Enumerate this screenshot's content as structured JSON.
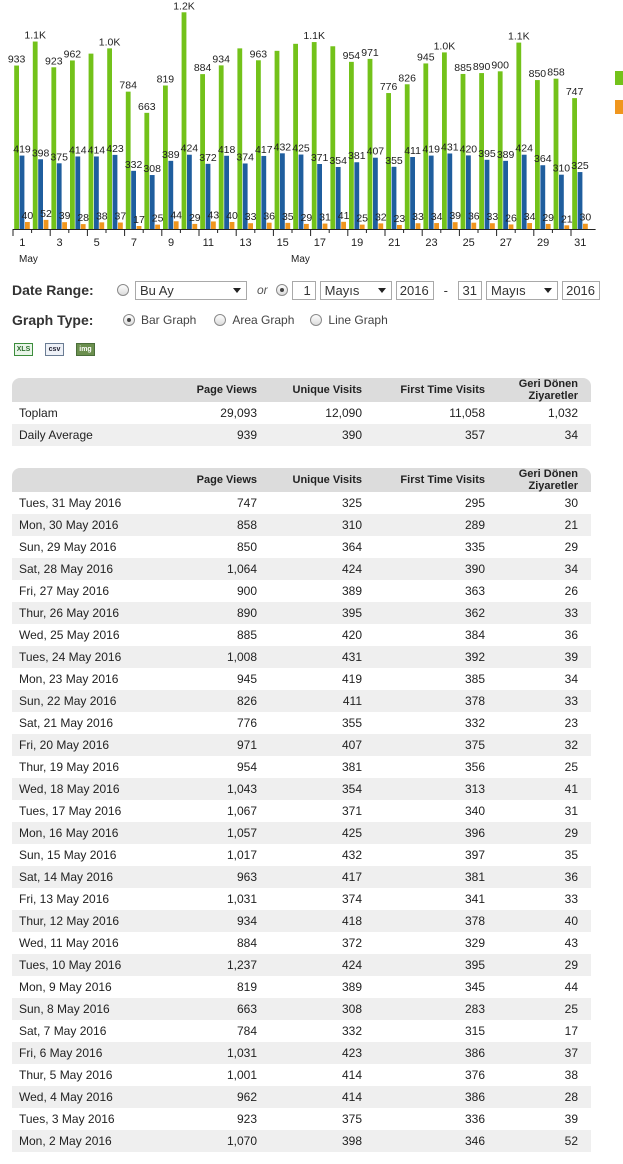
{
  "chart_data": {
    "type": "bar",
    "x": [
      1,
      2,
      3,
      4,
      5,
      6,
      7,
      8,
      9,
      10,
      11,
      12,
      13,
      14,
      15,
      16,
      17,
      18,
      19,
      20,
      21,
      22,
      23,
      24,
      25,
      26,
      27,
      28,
      29,
      30,
      31
    ],
    "x_tick_labels": [
      "1",
      "3",
      "5",
      "7",
      "9",
      "11",
      "13",
      "15",
      "17",
      "19",
      "21",
      "23",
      "25",
      "27",
      "29",
      "31"
    ],
    "month_labels": [
      "May",
      "May"
    ],
    "series": [
      {
        "color": "#73c21a",
        "values": [
          933,
          1070,
          923,
          962,
          1001,
          1031,
          784,
          663,
          819,
          1237,
          884,
          934,
          1031,
          963,
          1017,
          1057,
          1067,
          1043,
          954,
          971,
          776,
          826,
          945,
          1008,
          885,
          890,
          900,
          1064,
          850,
          858,
          747
        ],
        "labels": [
          "933",
          "1.1K",
          "923",
          "962",
          "",
          "1.0K",
          "784",
          "663",
          "819",
          "1.2K",
          "884",
          "934",
          "",
          "963",
          "",
          "",
          "1.1K",
          "",
          "954",
          "971",
          "776",
          "826",
          "945",
          "1.0K",
          "885",
          "890",
          "900",
          "1.1K",
          "850",
          "858",
          "747"
        ]
      },
      {
        "color": "#1f5e9e",
        "values": [
          419,
          398,
          375,
          414,
          414,
          423,
          332,
          308,
          389,
          424,
          372,
          418,
          374,
          417,
          432,
          425,
          371,
          354,
          381,
          407,
          355,
          411,
          419,
          431,
          420,
          395,
          389,
          424,
          364,
          310,
          325
        ],
        "labels": [
          "419",
          "398",
          "375",
          "414",
          "414",
          "423",
          "332",
          "308",
          "389",
          "424",
          "372",
          "418",
          "374",
          "417",
          "432",
          "425",
          "371",
          "354",
          "381",
          "407",
          "355",
          "411",
          "419",
          "431",
          "420",
          "395",
          "389",
          "424",
          "364",
          "310",
          "325"
        ]
      },
      {
        "color": "#f0961e",
        "values": [
          40,
          52,
          39,
          28,
          38,
          37,
          17,
          25,
          44,
          29,
          43,
          40,
          33,
          36,
          35,
          29,
          31,
          41,
          25,
          32,
          23,
          33,
          34,
          39,
          36,
          33,
          26,
          34,
          29,
          21,
          30
        ],
        "labels": [
          "40",
          "52",
          "39",
          "28",
          "38",
          "37",
          "17",
          "25",
          "44",
          "29",
          "43",
          "40",
          "33",
          "36",
          "35",
          "29",
          "31",
          "41",
          "25",
          "32",
          "23",
          "33",
          "34",
          "39",
          "36",
          "33",
          "26",
          "34",
          "29",
          "21",
          "30"
        ]
      }
    ],
    "ylim": [
      0,
      1250
    ],
    "legend_colors": [
      "#73c21a",
      "#f0961e"
    ]
  },
  "controls": {
    "date_range_label": "Date Range:",
    "preset_value": "Bu Ay",
    "or_text": "or",
    "from_day": "1",
    "from_month": "Mayıs",
    "from_year": "2016",
    "dash": "-",
    "to_day": "31",
    "to_month": "Mayıs",
    "to_year": "2016",
    "graph_type_label": "Graph Type:",
    "bar_graph": "Bar Graph",
    "area_graph": "Area Graph",
    "line_graph": "Line Graph"
  },
  "export_icons": [
    "excel-icon",
    "csv-icon",
    "image-icon"
  ],
  "summary": {
    "headers": [
      "",
      "Page Views",
      "Unique Visits",
      "First Time Visits",
      "Geri Dönen Ziyaretler"
    ],
    "rows": [
      [
        "Toplam",
        "29,093",
        "12,090",
        "11,058",
        "1,032"
      ],
      [
        "Daily Average",
        "939",
        "390",
        "357",
        "34"
      ]
    ]
  },
  "daily": {
    "headers": [
      "",
      "Page Views",
      "Unique Visits",
      "First Time Visits",
      "Geri Dönen Ziyaretler"
    ],
    "rows": [
      [
        "Tues, 31 May 2016",
        "747",
        "325",
        "295",
        "30"
      ],
      [
        "Mon, 30 May 2016",
        "858",
        "310",
        "289",
        "21"
      ],
      [
        "Sun, 29 May 2016",
        "850",
        "364",
        "335",
        "29"
      ],
      [
        "Sat, 28 May 2016",
        "1,064",
        "424",
        "390",
        "34"
      ],
      [
        "Fri, 27 May 2016",
        "900",
        "389",
        "363",
        "26"
      ],
      [
        "Thur, 26 May 2016",
        "890",
        "395",
        "362",
        "33"
      ],
      [
        "Wed, 25 May 2016",
        "885",
        "420",
        "384",
        "36"
      ],
      [
        "Tues, 24 May 2016",
        "1,008",
        "431",
        "392",
        "39"
      ],
      [
        "Mon, 23 May 2016",
        "945",
        "419",
        "385",
        "34"
      ],
      [
        "Sun, 22 May 2016",
        "826",
        "411",
        "378",
        "33"
      ],
      [
        "Sat, 21 May 2016",
        "776",
        "355",
        "332",
        "23"
      ],
      [
        "Fri, 20 May 2016",
        "971",
        "407",
        "375",
        "32"
      ],
      [
        "Thur, 19 May 2016",
        "954",
        "381",
        "356",
        "25"
      ],
      [
        "Wed, 18 May 2016",
        "1,043",
        "354",
        "313",
        "41"
      ],
      [
        "Tues, 17 May 2016",
        "1,067",
        "371",
        "340",
        "31"
      ],
      [
        "Mon, 16 May 2016",
        "1,057",
        "425",
        "396",
        "29"
      ],
      [
        "Sun, 15 May 2016",
        "1,017",
        "432",
        "397",
        "35"
      ],
      [
        "Sat, 14 May 2016",
        "963",
        "417",
        "381",
        "36"
      ],
      [
        "Fri, 13 May 2016",
        "1,031",
        "374",
        "341",
        "33"
      ],
      [
        "Thur, 12 May 2016",
        "934",
        "418",
        "378",
        "40"
      ],
      [
        "Wed, 11 May 2016",
        "884",
        "372",
        "329",
        "43"
      ],
      [
        "Tues, 10 May 2016",
        "1,237",
        "424",
        "395",
        "29"
      ],
      [
        "Mon, 9 May 2016",
        "819",
        "389",
        "345",
        "44"
      ],
      [
        "Sun, 8 May 2016",
        "663",
        "308",
        "283",
        "25"
      ],
      [
        "Sat, 7 May 2016",
        "784",
        "332",
        "315",
        "17"
      ],
      [
        "Fri, 6 May 2016",
        "1,031",
        "423",
        "386",
        "37"
      ],
      [
        "Thur, 5 May 2016",
        "1,001",
        "414",
        "376",
        "38"
      ],
      [
        "Wed, 4 May 2016",
        "962",
        "414",
        "386",
        "28"
      ],
      [
        "Tues, 3 May 2016",
        "923",
        "375",
        "336",
        "39"
      ],
      [
        "Mon, 2 May 2016",
        "1,070",
        "398",
        "346",
        "52"
      ]
    ]
  }
}
